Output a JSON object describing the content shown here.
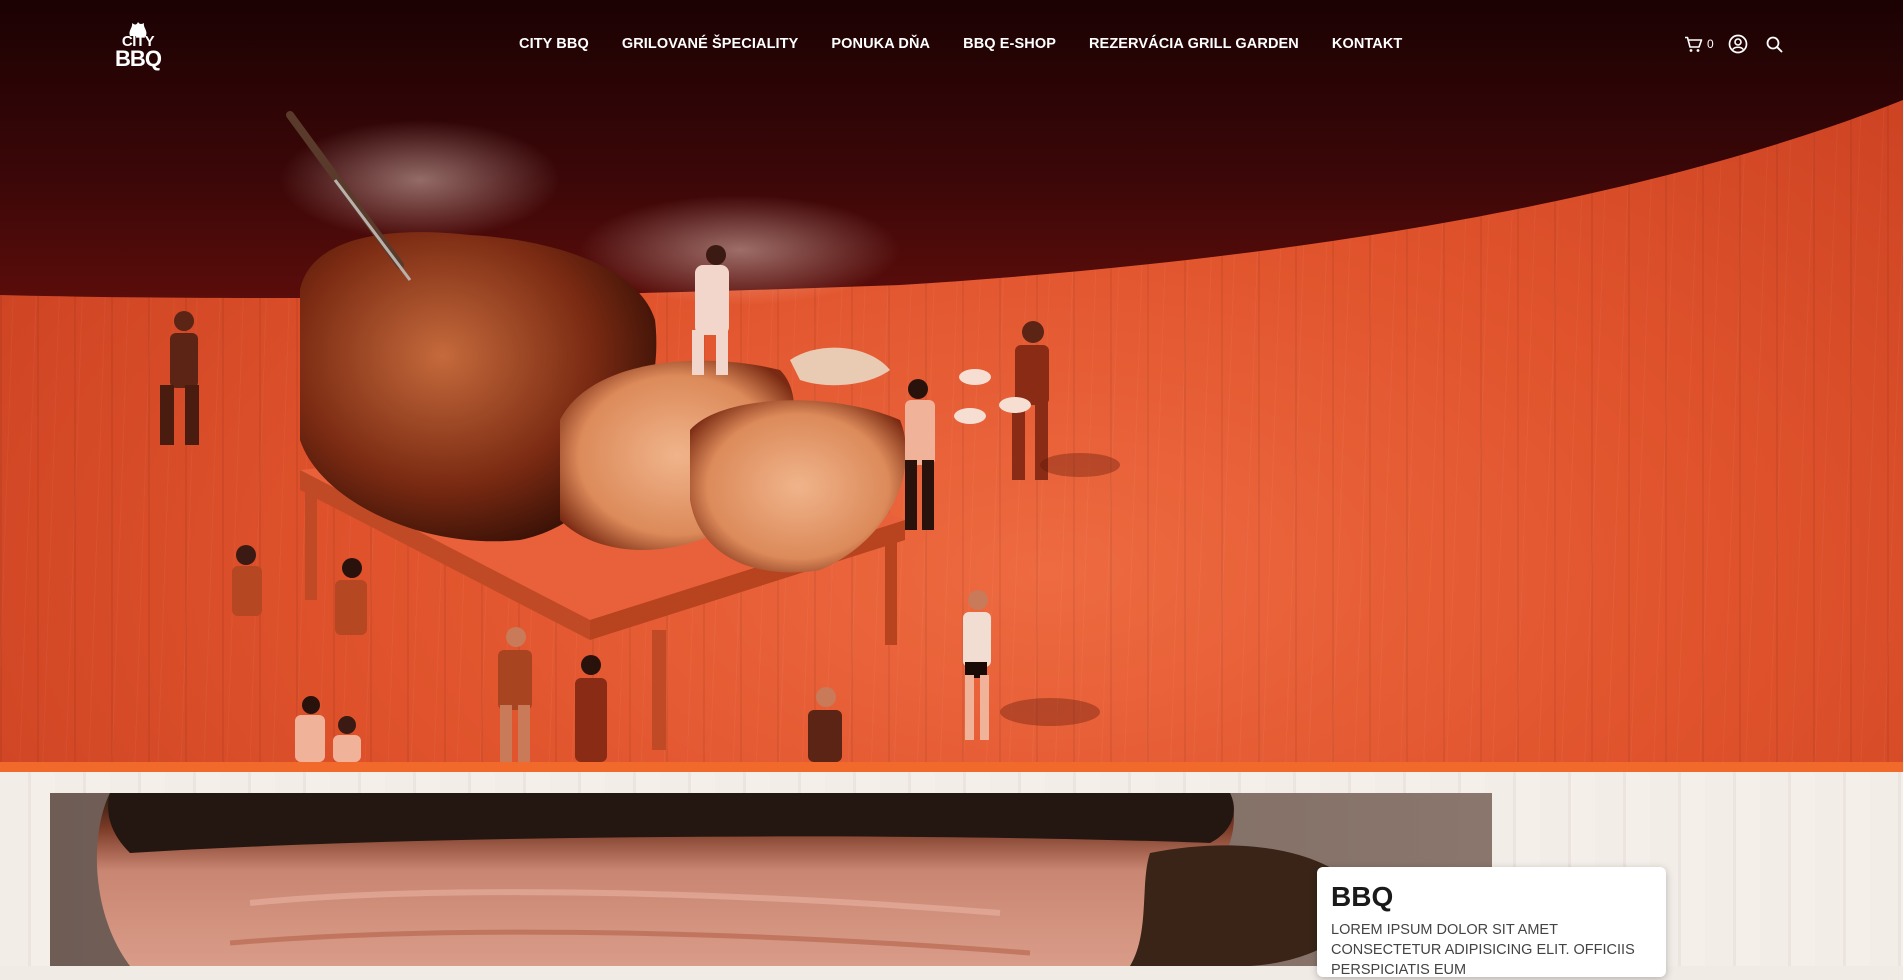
{
  "header": {
    "logo": {
      "line1": "CITY",
      "line2": "BBQ"
    },
    "nav": [
      {
        "label": "CITY BBQ"
      },
      {
        "label": "GRILOVANÉ ŠPECIALITY"
      },
      {
        "label": "PONUKA DŇA"
      },
      {
        "label": "BBQ E-SHOP"
      },
      {
        "label": "REZERVÁCIA GRILL GARDEN"
      },
      {
        "label": "KONTAKT"
      }
    ],
    "cart_count": "0",
    "icons": [
      "cart-icon",
      "user-icon",
      "search-icon"
    ]
  },
  "feature_card": {
    "title": "BBQ",
    "text": "LOREM IPSUM DOLOR SIT AMET CONSECTETUR ADIPISICING ELIT. OFFICIIS PERSPICIATIS EUM"
  },
  "colors": {
    "hero_dark": "#2a0506",
    "hero_orange": "#e0532c",
    "accent_bar": "#f26a2b",
    "text_light": "#ffffff"
  }
}
